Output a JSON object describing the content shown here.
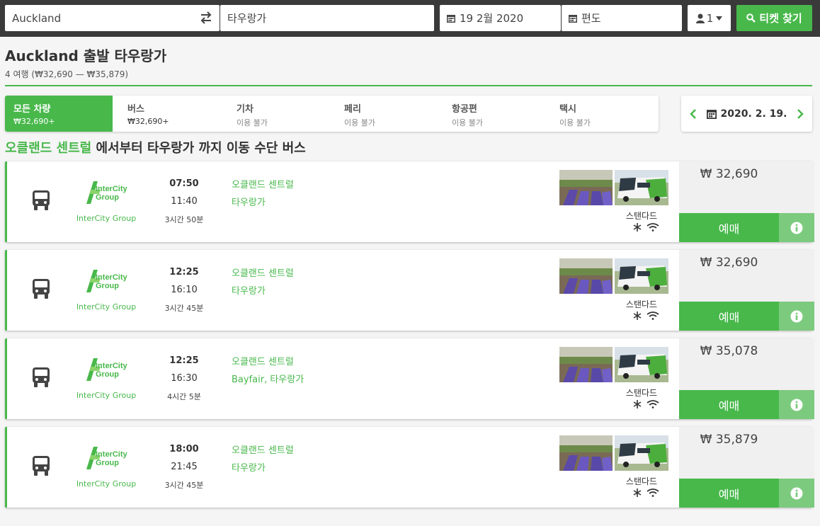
{
  "search": {
    "from": "Auckland",
    "to": "타우랑가",
    "date": "19 2월 2020",
    "return": "편도",
    "passengers": "1",
    "button": "티켓 찾기"
  },
  "header": {
    "title": "Auckland 출발 타우랑가",
    "subtitle": "4 여행 (₩32,690 — ₩35,879)"
  },
  "tabs": [
    {
      "label": "모든 차량",
      "sub": "₩32,690+"
    },
    {
      "label": "버스",
      "sub": "₩32,690+"
    },
    {
      "label": "기차",
      "sub": "이용 불가"
    },
    {
      "label": "페리",
      "sub": "이용 불가"
    },
    {
      "label": "항공편",
      "sub": "이용 불가"
    },
    {
      "label": "택시",
      "sub": "이용 불가"
    }
  ],
  "date_picker": {
    "date": "2020. 2. 19."
  },
  "route_heading": {
    "origin": "오클랜드 센트럴",
    "rest": " 에서부터 타우랑가 까지 이동 수단 버스"
  },
  "results": [
    {
      "company": "InterCity Group",
      "dep": "07:50",
      "arr": "11:40",
      "duration": "3시간 50분",
      "from": "오클랜드 센트럴",
      "to": "타우랑가",
      "class": "스탠다드",
      "price": "₩ 32,690",
      "buy": "예매"
    },
    {
      "company": "InterCity Group",
      "dep": "12:25",
      "arr": "16:10",
      "duration": "3시간 45분",
      "from": "오클랜드 센트럴",
      "to": "타우랑가",
      "class": "스탠다드",
      "price": "₩ 32,690",
      "buy": "예매"
    },
    {
      "company": "InterCity Group",
      "dep": "12:25",
      "arr": "16:30",
      "duration": "4시간 5분",
      "from": "오클랜드 센트럴",
      "to": "Bayfair, 타우랑가",
      "class": "스탠다드",
      "price": "₩ 35,078",
      "buy": "예매"
    },
    {
      "company": "InterCity Group",
      "dep": "18:00",
      "arr": "21:45",
      "duration": "3시간 45분",
      "from": "오클랜드 센트럴",
      "to": "타우랑가",
      "class": "스탠다드",
      "price": "₩ 35,879",
      "buy": "예매"
    }
  ],
  "logo_text": {
    "line1": "InterCity",
    "line2": "Group"
  },
  "colors": {
    "accent": "#48b84b",
    "topbar": "#3a3a3a"
  },
  "icons": {
    "swap": "swap-icon",
    "calendar": "calendar-icon",
    "user": "user-icon",
    "search": "search-icon",
    "bus": "bus-icon",
    "snowflake": "snowflake-icon",
    "wifi": "wifi-icon",
    "info": "info-icon"
  }
}
